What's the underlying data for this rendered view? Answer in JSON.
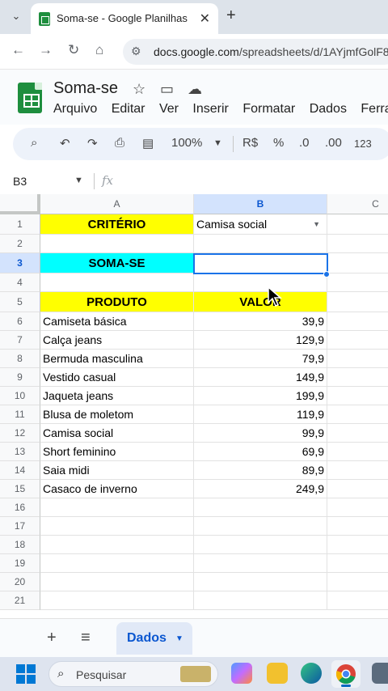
{
  "browser": {
    "tab_title": "Soma-se - Google Planilhas",
    "url_host": "docs.google.com",
    "url_path": "/spreadsheets/d/1AYjmfGolF8L"
  },
  "doc": {
    "name": "Soma-se",
    "menu": [
      "Arquivo",
      "Editar",
      "Ver",
      "Inserir",
      "Formatar",
      "Dados",
      "Ferra"
    ]
  },
  "toolbar": {
    "zoom": "100%",
    "currency": "R$",
    "percent": "%",
    "dec_decrease": ".0",
    "dec_increase": ".00",
    "format_more": "123"
  },
  "formula_bar": {
    "cell_ref": "B3",
    "fx_label": "fx"
  },
  "grid": {
    "columns": [
      "A",
      "B",
      "C"
    ],
    "rows": [
      "1",
      "2",
      "3",
      "4",
      "5",
      "6",
      "7",
      "8",
      "9",
      "10",
      "11",
      "12",
      "13",
      "14",
      "15",
      "16",
      "17",
      "18",
      "19",
      "20",
      "21"
    ],
    "criterio_label": "CRITÉRIO",
    "criterio_value": "Camisa social",
    "somase_label": "SOMA-SE",
    "somase_value": "",
    "header_produto": "PRODUTO",
    "header_valor": "VALOR",
    "products": [
      {
        "produto": "Camiseta básica",
        "valor": "39,9"
      },
      {
        "produto": "Calça jeans",
        "valor": "129,9"
      },
      {
        "produto": "Bermuda masculina",
        "valor": "79,9"
      },
      {
        "produto": "Vestido casual",
        "valor": "149,9"
      },
      {
        "produto": "Jaqueta jeans",
        "valor": "199,9"
      },
      {
        "produto": "Blusa de moletom",
        "valor": "119,9"
      },
      {
        "produto": "Camisa social",
        "valor": "99,9"
      },
      {
        "produto": "Short feminino",
        "valor": "69,9"
      },
      {
        "produto": "Saia midi",
        "valor": "89,9"
      },
      {
        "produto": "Casaco de inverno",
        "valor": "249,9"
      }
    ]
  },
  "sheets": {
    "active": "Dados"
  },
  "taskbar": {
    "search_placeholder": "Pesquisar"
  },
  "colors": {
    "yellow_fill": "#ffff00",
    "cyan_fill": "#00ffff",
    "selection": "#1a73e8",
    "sheets_green": "#1e8e3e"
  }
}
